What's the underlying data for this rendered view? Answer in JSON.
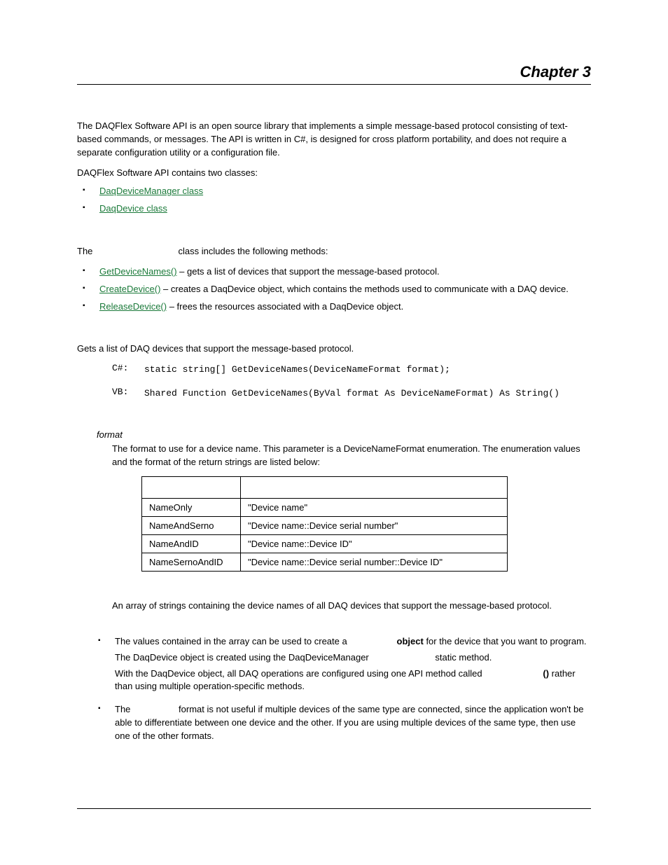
{
  "header": {
    "chapter": "Chapter 3"
  },
  "intro": {
    "p1": "The DAQFlex Software API is an open source library that implements a simple message-based protocol consisting of text-based commands, or messages. The API is written in C#, is designed for cross platform portability, and does not require a separate configuration utility or a configuration file.",
    "p2": "DAQFlex Software API contains two classes:",
    "class_links": [
      "DaqDeviceManager class",
      "DaqDevice class"
    ]
  },
  "section1": {
    "lead_pre": "The ",
    "lead_post": " class includes the following methods:",
    "methods": [
      {
        "link": "GetDeviceNames()",
        "desc": " – gets a list of devices that support the message-based protocol."
      },
      {
        "link": "CreateDevice()",
        "desc": " – creates a DaqDevice object, which contains the methods used to communicate with a DAQ device."
      },
      {
        "link": "ReleaseDevice()",
        "desc": " – frees the resources associated with a DaqDevice object."
      }
    ]
  },
  "section2": {
    "desc": "Gets a list of DAQ devices that support the message-based protocol.",
    "sig": {
      "cs_label": "C#:",
      "cs_code": "static string[] GetDeviceNames(DeviceNameFormat format);",
      "vb_label": "VB:",
      "vb_code": "Shared Function GetDeviceNames(ByVal format As DeviceNameFormat) As String()"
    },
    "param": {
      "name": "format",
      "desc": "The format to use for a device name. This parameter is a DeviceNameFormat enumeration. The enumeration values and the format of the return strings are listed below:",
      "table": {
        "rows": [
          {
            "c1": "NameOnly",
            "c2": "\"Device name\""
          },
          {
            "c1": "NameAndSerno",
            "c2": "\"Device name::Device serial number\""
          },
          {
            "c1": "NameAndID",
            "c2": "\"Device name::Device ID\""
          },
          {
            "c1": "NameSernoAndID",
            "c2": "\"Device name::Device serial number::Device ID\""
          }
        ]
      }
    },
    "returns": "An array of strings containing the device names of all DAQ devices that support the message-based protocol.",
    "remarks": {
      "r1_a": "The values contained in the array can be used to create a ",
      "r1_bold": "object",
      "r1_b": " for the device that you want to program.",
      "r1_line2": "The DaqDevice object is created using the DaqDeviceManager ",
      "r1_line2_b": " static method.",
      "r1_line3_a": "With the DaqDevice object, all DAQ operations are configured using one API method called ",
      "r1_line3_bold": "()",
      "r1_line3_b": " rather than using multiple operation-specific methods.",
      "r2_a": "The ",
      "r2_b": " format is not useful if multiple devices of the same type are connected, since the application won't be able to differentiate between one device and the other. If you are using multiple devices of the same type, then use one of the other formats."
    }
  }
}
